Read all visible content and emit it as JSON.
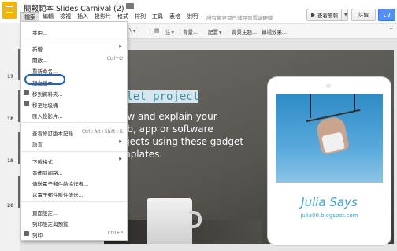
{
  "app": {
    "title": "簡報範本 Slides Carnival (2)",
    "save_status": "所有變更都已儲存到雲端硬碟",
    "star_glyph": "☆"
  },
  "menubar": [
    {
      "label": "檔案",
      "active": true
    },
    {
      "label": "編輯"
    },
    {
      "label": "檢視"
    },
    {
      "label": "插入"
    },
    {
      "label": "投影片"
    },
    {
      "label": "格式"
    },
    {
      "label": "排列"
    },
    {
      "label": "工具"
    },
    {
      "label": "表格"
    },
    {
      "label": "說明"
    }
  ],
  "header_buttons": {
    "present": "查看簡報",
    "comment": "註解"
  },
  "toolbar": {
    "t1": "注",
    "t2": "背景...",
    "t3": "配置",
    "t4": "背景主題...",
    "t5": "轉場效果..."
  },
  "file_menu": {
    "items": [
      {
        "label": "共用...",
        "shortcut": ""
      },
      {
        "label": "新增",
        "submenu": true
      },
      {
        "label": "開啟...",
        "shortcut": "Ctrl+O"
      },
      {
        "label": "重新命名...",
        "shortcut": ""
      },
      {
        "label": "建立副本...",
        "shortcut": "",
        "highlighted": true
      },
      {
        "label": "移到資料夾...",
        "shortcut": "",
        "icon": "folder-icon"
      },
      {
        "label": "移至垃圾桶",
        "shortcut": "",
        "icon": "trash-icon"
      },
      {
        "label": "匯入投影片...",
        "shortcut": ""
      },
      {
        "label": "查看修訂版本記錄",
        "shortcut": "Ctrl+Alt+Shift+G"
      },
      {
        "label": "語言",
        "submenu": true
      },
      {
        "label": "下載格式",
        "submenu": true
      },
      {
        "label": "發佈到網路...",
        "shortcut": ""
      },
      {
        "label": "傳送電子郵件給協作者...",
        "shortcut": ""
      },
      {
        "label": "以電子郵件附件傳送...",
        "shortcut": ""
      },
      {
        "label": "頁面設定...",
        "shortcut": ""
      },
      {
        "label": "列印設定與預覽",
        "shortcut": ""
      },
      {
        "label": "列印",
        "shortcut": "Ctrl+P",
        "icon": "print-icon"
      }
    ]
  },
  "filmstrip": {
    "slide_numbers": [
      "17",
      "18",
      "19",
      "20"
    ]
  },
  "slide": {
    "title": "blet project",
    "body_lines": [
      "ow and explain your",
      "eb, app or software",
      "ojects using these gadget",
      "mplates."
    ],
    "tablet_name": "Julia Says",
    "tablet_blog": "julia00.blogspot.com"
  },
  "colors": {
    "accent_blue": "#4d90fe",
    "highlight_ring": "#1e63b8",
    "slide_title": "#3f8fa0",
    "tablet_text": "#3aa3d4",
    "app_icon": "#f4b400"
  }
}
